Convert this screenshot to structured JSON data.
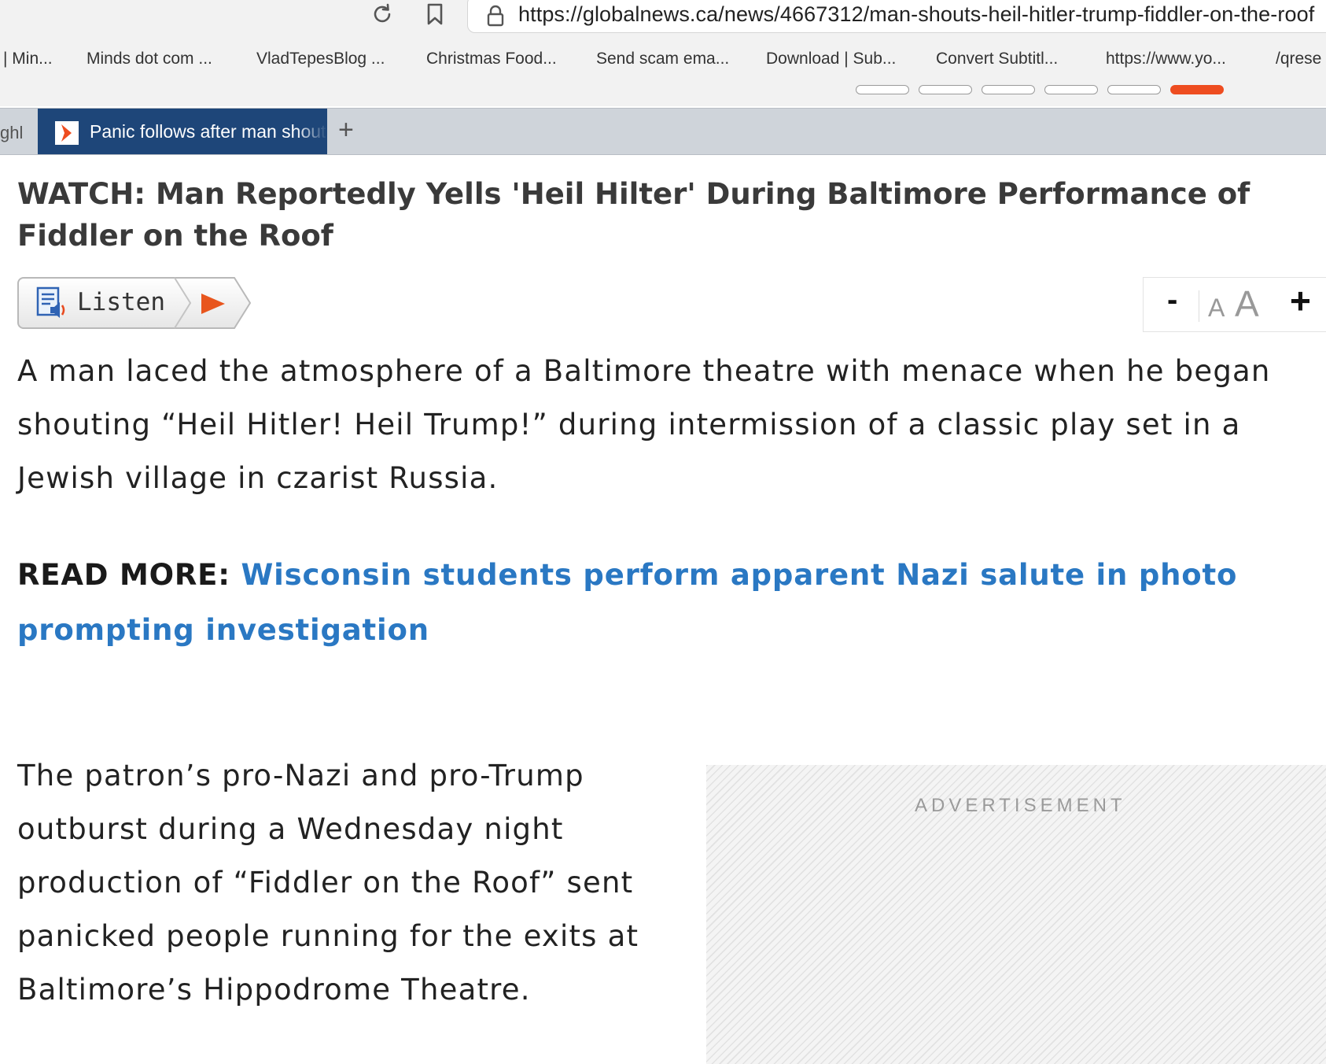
{
  "browser": {
    "url": "https://globalnews.ca/news/4667312/man-shouts-heil-hitler-trump-fiddler-on-the-roof",
    "bookmarks": [
      "| Min...",
      "Minds dot com ...",
      "VladTepesBlog ...",
      "Christmas Food...",
      "Send scam ema...",
      "Download | Sub...",
      "Convert Subtitl...",
      "https://www.yo...",
      "/qrese"
    ],
    "tabs": {
      "previous_stub": "ghl",
      "active_title": "Panic follows after man shouts",
      "new_tab_label": "+"
    },
    "accent_color": "#ee4d20",
    "tab_color": "#1e4679"
  },
  "article": {
    "headline": "WATCH: Man Reportedly Yells 'Heil Hilter' During Baltimore Performance of Fiddler on the Roof",
    "listen_label": "Listen",
    "font_controls": {
      "minus": "-",
      "small": "A",
      "large": "A",
      "plus": "+"
    },
    "paragraph_1": "A man laced the atmosphere of a Baltimore theatre with menace when he began shouting “Heil Hitler! Heil Trump!” during intermission of a classic play set in a Jewish village in czarist Russia.",
    "read_more_label": "READ MORE:",
    "read_more_link": "Wisconsin students perform apparent Nazi salute in photo prompting investigation",
    "paragraph_2": "The patron’s pro-Nazi and pro-Trump outburst during a Wednesday night production of “Fiddler on the Roof” sent panicked people running for the exits at Baltimore’s Hippodrome Theatre.",
    "advertisement_label": "ADVERTISEMENT",
    "link_color": "#2a78c3"
  }
}
